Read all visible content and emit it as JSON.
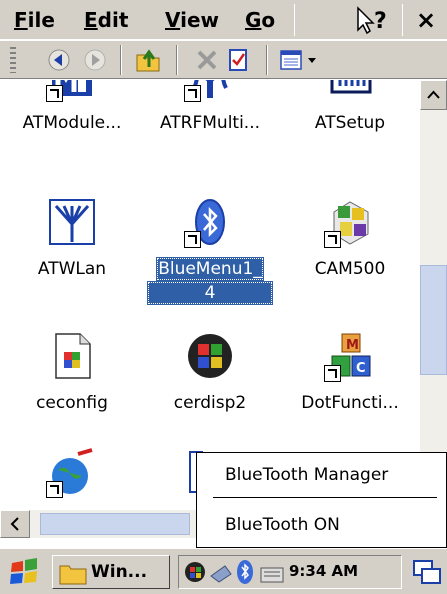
{
  "menubar": {
    "items": [
      "File",
      "Edit",
      "View",
      "Go"
    ],
    "help_label": "?",
    "close_label": "×"
  },
  "toolbar": {
    "buttons": [
      "back-icon",
      "forward-icon",
      "up-folder-icon",
      "delete-icon",
      "properties-icon",
      "view-menu-icon"
    ]
  },
  "files": [
    {
      "label": "ATModule...",
      "icon": "atmodule-icon",
      "shortcut": true
    },
    {
      "label": "ATRFMulti...",
      "icon": "atrfmulti-icon",
      "shortcut": true
    },
    {
      "label": "ATSetup",
      "icon": "atsetup-icon",
      "shortcut": false
    },
    {
      "label": "ATWLan",
      "icon": "antenna-icon",
      "shortcut": false
    },
    {
      "label": "BlueMenu1_",
      "label2": "4",
      "icon": "bluetooth-icon",
      "shortcut": true,
      "selected": true
    },
    {
      "label": "CAM500",
      "icon": "cam500-icon",
      "shortcut": true
    },
    {
      "label": "ceconfig",
      "icon": "ceconfig-icon",
      "shortcut": false
    },
    {
      "label": "cerdisp2",
      "icon": "cerdisp-icon",
      "shortcut": false
    },
    {
      "label": "DotFuncti...",
      "icon": "dotfunction-icon",
      "shortcut": true
    }
  ],
  "context_menu": {
    "items": [
      "BlueTooth Manager",
      "BlueTooth ON"
    ]
  },
  "taskbar": {
    "task_label": "Win...",
    "clock": "9:34 AM"
  },
  "colors": {
    "chrome": "#d4d0c8",
    "selection": "#2f5fa7",
    "scroll_thumb": "#c9d6ee"
  }
}
